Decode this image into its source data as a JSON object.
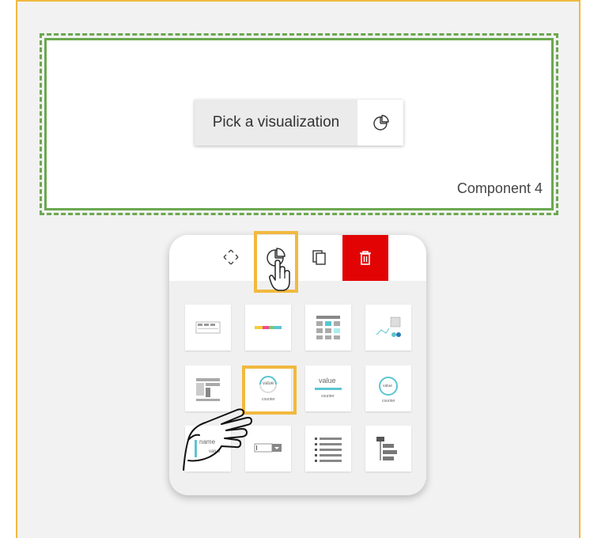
{
  "canvas": {
    "pick_label": "Pick a visualization",
    "component_name": "Component 4"
  },
  "toolbar": {
    "buttons": [
      {
        "name": "move",
        "icon": "move-icon"
      },
      {
        "name": "visualization",
        "icon": "pie-chart-icon"
      },
      {
        "name": "duplicate",
        "icon": "copy-icon"
      },
      {
        "name": "delete",
        "icon": "trash-icon"
      }
    ]
  },
  "tiles": {
    "value_text": "value",
    "counter_text": "counter",
    "name_text": "name"
  },
  "colors": {
    "highlight": "#f1b940",
    "component_border": "#6aa84f",
    "delete": "#e20404",
    "accent": "#5bc6d0"
  }
}
